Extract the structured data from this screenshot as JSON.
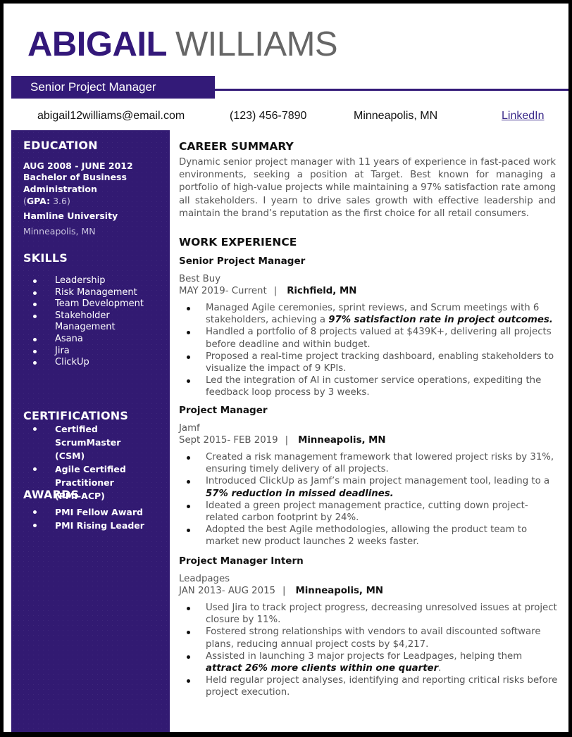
{
  "header": {
    "first_name": "ABIGAIL",
    "last_name": "WILLIAMS",
    "job_title": "Senior Project Manager",
    "brand_color": "#331a78"
  },
  "contact": {
    "email": "abigail12williams@email.com",
    "phone": "(123) 456-7890",
    "location": "Minneapolis, MN",
    "linkedin_label": "LinkedIn"
  },
  "sidebar": {
    "education": {
      "heading": "EDUCATION",
      "dates": "AUG 2008 - JUNE 2012",
      "degree_line1": "Bachelor of Business",
      "degree_line2": "Administration",
      "gpa_label": "GPA:",
      "gpa_value": "3.6",
      "school": "Hamline University",
      "location": "Minneapolis, MN"
    },
    "skills": {
      "heading": "SKILLS",
      "items": [
        "Leadership",
        "Risk Management",
        "Team Development",
        "Stakeholder Management",
        "Asana",
        "Jira",
        "ClickUp"
      ]
    },
    "certifications": {
      "heading": "CERTIFICATIONS",
      "items": [
        "Certified ScrumMaster (CSM)",
        "Agile Certified Practitioner (PMI-ACP)"
      ]
    },
    "awards": {
      "heading": "AWARDS",
      "items": [
        "PMI Fellow Award",
        "PMI Rising Leader"
      ]
    }
  },
  "main": {
    "summary": {
      "heading": "CAREER SUMMARY",
      "text": "Dynamic senior project manager with 11 years of experience in fast-paced work environments, seeking a position at Target. Best known for managing a portfolio of high-value projects while maintaining a 97% satisfaction rate among all stakeholders. I yearn to drive sales growth with effective leadership and maintain the brand’s reputation as the first choice for all retail consumers."
    },
    "experience": {
      "heading": "WORK EXPERIENCE",
      "separator": "|",
      "jobs": [
        {
          "title": "Senior Project Manager",
          "company": "Best Buy",
          "dates": "MAY 2019- Current",
          "location": "Richfield, MN",
          "bullets": [
            {
              "text": "Managed Agile ceremonies, sprint reviews, and Scrum meetings with 6 stakeholders, achieving a ",
              "bold": "97% satisfaction rate in project outcomes.",
              "after": ""
            },
            {
              "text": "Handled a portfolio of 8 projects valued at $439K+, delivering all projects before deadline and within budget.",
              "bold": "",
              "after": ""
            },
            {
              "text": "Proposed a real-time project tracking dashboard, enabling stakeholders to visualize the impact of 9 KPIs.",
              "bold": "",
              "after": ""
            },
            {
              "text": "Led the integration of AI in customer service operations, expediting the feedback loop process by 3 weeks.",
              "bold": "",
              "after": ""
            }
          ]
        },
        {
          "title": "Project Manager",
          "company": "Jamf",
          "dates": "Sept 2015- FEB 2019",
          "location": "Minneapolis, MN",
          "bullets": [
            {
              "text": "Created a risk management framework that lowered project risks by 31%, ensuring timely delivery of all projects.",
              "bold": "",
              "after": ""
            },
            {
              "text": "Introduced ClickUp as Jamf’s main project management tool, leading to a ",
              "bold": "57% reduction in missed deadlines.",
              "after": ""
            },
            {
              "text": "Ideated a green project management practice, cutting down project-related carbon footprint by 24%.",
              "bold": "",
              "after": ""
            },
            {
              "text": "Adopted the best Agile methodologies, allowing the product team to market new product launches 2 weeks faster.",
              "bold": "",
              "after": ""
            }
          ]
        },
        {
          "title": "Project Manager Intern",
          "company": "Leadpages",
          "dates": "JAN 2013- AUG 2015",
          "location": "Minneapolis, MN",
          "bullets": [
            {
              "text": "Used Jira to track project progress, decreasing unresolved issues at project closure by 11%.",
              "bold": "",
              "after": ""
            },
            {
              "text": "Fostered strong relationships with vendors to avail discounted software plans, reducing annual project costs by $4,217.",
              "bold": "",
              "after": ""
            },
            {
              "text": "Assisted in launching 3 major projects for Leadpages, helping them ",
              "bold": "attract 26% more clients within one quarter",
              "after": "."
            },
            {
              "text": "Held regular project analyses, identifying and reporting critical risks before project execution.",
              "bold": "",
              "after": ""
            }
          ]
        }
      ]
    }
  }
}
